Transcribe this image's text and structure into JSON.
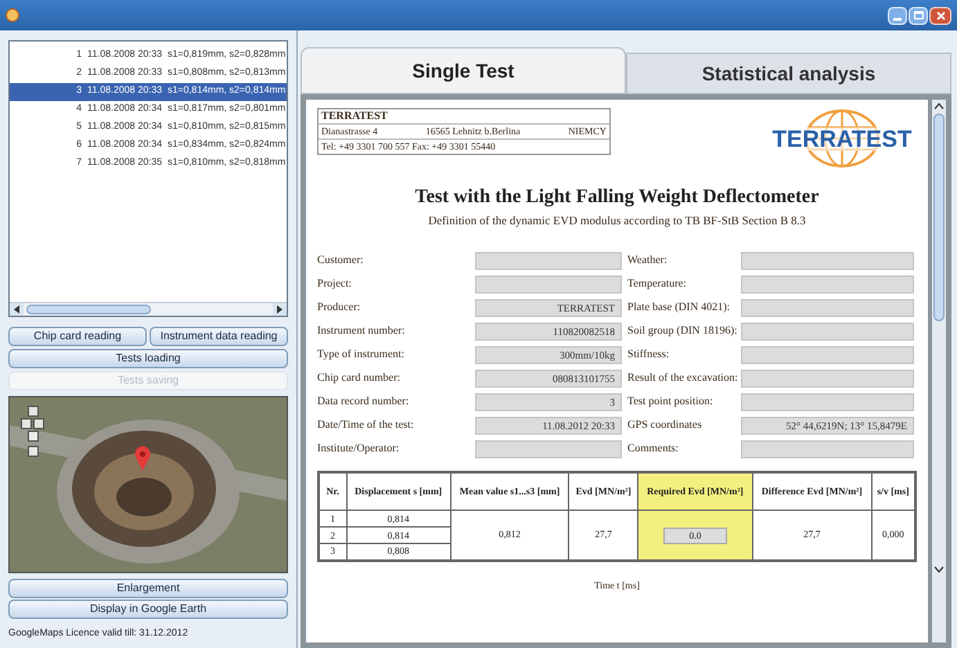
{
  "records": [
    {
      "nr": "1",
      "datetime": "11.08.2008 20:33",
      "values": "s1=0,819mm, s2=0,828mm",
      "selected": false
    },
    {
      "nr": "2",
      "datetime": "11.08.2008 20:33",
      "values": "s1=0,808mm, s2=0,813mm",
      "selected": false
    },
    {
      "nr": "3",
      "datetime": "11.08.2008 20:33",
      "values": "s1=0,814mm, s2=0,814mm",
      "selected": true
    },
    {
      "nr": "4",
      "datetime": "11.08.2008 20:34",
      "values": "s1=0,817mm, s2=0,801mm",
      "selected": false
    },
    {
      "nr": "5",
      "datetime": "11.08.2008 20:34",
      "values": "s1=0,810mm, s2=0,815mm",
      "selected": false
    },
    {
      "nr": "6",
      "datetime": "11.08.2008 20:34",
      "values": "s1=0,834mm, s2=0,824mm",
      "selected": false
    },
    {
      "nr": "7",
      "datetime": "11.08.2008 20:35",
      "values": "s1=0,810mm, s2=0,818mm",
      "selected": false
    }
  ],
  "buttons_top": [
    {
      "label": "Chip card reading",
      "disabled": false
    },
    {
      "label": "Instrument data reading",
      "disabled": false
    }
  ],
  "buttons_mid": [
    {
      "label": "Tests loading",
      "disabled": false
    },
    {
      "label": "Tests saving",
      "disabled": true
    }
  ],
  "buttons_bottom": [
    {
      "label": "Enlargement",
      "disabled": false
    },
    {
      "label": "Display in Google Earth",
      "disabled": false
    }
  ],
  "license_note": "GoogleMaps Licence valid till: 31.12.2012",
  "tabs": [
    {
      "label": "Single Test",
      "selected": true
    },
    {
      "label": "Statistical analysis",
      "selected": false
    }
  ],
  "report": {
    "company": {
      "name": "TERRATEST",
      "street": "Dianastrasse 4",
      "city": "16565 Lehnitz b.Berlina",
      "country": "NIEMCY",
      "phone": "Tel: +49 3301 700 557  Fax: +49 3301 55440"
    },
    "logo_text": "TERRATEST",
    "title": "Test with the Light Falling Weight Deflectometer",
    "subtitle": "Definition of the dynamic EVD modulus according to TB BF-StB Section B 8.3",
    "fields_left": [
      {
        "label": "Customer:"
      },
      {
        "label": "Project:"
      },
      {
        "label": "Producer:",
        "value": "TERRATEST"
      },
      {
        "label": "Instrument number:",
        "value": "110820082518"
      },
      {
        "label": "Type of instrument:",
        "value": "300mm/10kg"
      },
      {
        "label": "Chip card number:",
        "value": "080813101755"
      },
      {
        "label": "Data record number:",
        "value": "3"
      },
      {
        "label": "Date/Time of the test:",
        "value": "11.08.2012 20:33"
      },
      {
        "label": "Institute/Operator:"
      }
    ],
    "fields_right": [
      {
        "label": "Weather:"
      },
      {
        "label": "Temperature:"
      },
      {
        "label": "Plate base (DIN 4021):"
      },
      {
        "label": "Soil group (DIN 18196):"
      },
      {
        "label": "Stiffness:"
      },
      {
        "label": "Result of the excavation:"
      },
      {
        "label": "Test point position:"
      },
      {
        "label": "GPS coordinates",
        "value": "52° 44,6219N; 13° 15,8479E"
      },
      {
        "label": "Comments:"
      }
    ],
    "table": {
      "columns": [
        "Nr.",
        "Displacement s [mm]",
        "Mean value s1...s3 [mm]",
        "Evd [MN/m²]",
        "Required Evd [MN/m²]",
        "Difference Evd [MN/m²]",
        "s/v [ms]"
      ],
      "rows": [
        {
          "nr": "1",
          "displacement": "0,814"
        },
        {
          "nr": "2",
          "displacement": "0,814"
        },
        {
          "nr": "3",
          "displacement": "0,808"
        }
      ],
      "mean": "0,812",
      "evd": "27,7",
      "required": "0.0",
      "difference": "27,7",
      "sv": "0,000"
    },
    "axis_label": "Time t [ms]"
  }
}
